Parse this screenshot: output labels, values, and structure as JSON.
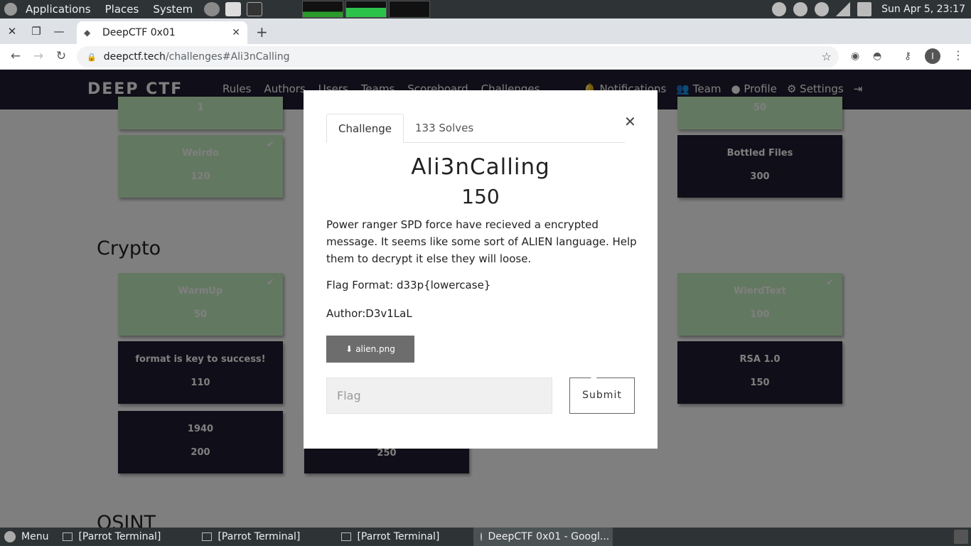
{
  "os": {
    "menus": [
      "Applications",
      "Places",
      "System"
    ],
    "clock": "Sun Apr  5, 23:17"
  },
  "browser": {
    "tab_title": "DeepCTF 0x01",
    "url_host": "deepctf.tech",
    "url_path": "/challenges#Ali3nCalling"
  },
  "site": {
    "logo": "DEEP CTF",
    "nav": [
      "Rules",
      "Authors",
      "Users",
      "Teams",
      "Scoreboard",
      "Challenges"
    ],
    "right_nav": [
      "Notifications",
      "Team",
      "Profile",
      "Settings"
    ]
  },
  "sections": {
    "crypto": "Crypto",
    "osint": "OSINT"
  },
  "cards": {
    "top_left_value": "1",
    "top_right_value": "50",
    "weirdo": {
      "name": "Weirdo",
      "value": "120"
    },
    "bottled": {
      "name": "Bottled Files",
      "value": "300"
    },
    "warmup": {
      "name": "WarmUp",
      "value": "50"
    },
    "wierdtext": {
      "name": "WierdText",
      "value": "100"
    },
    "format": {
      "name": "format is key to success!",
      "value": "110"
    },
    "rsa": {
      "name": "RSA 1.0",
      "value": "150"
    },
    "c1940": {
      "name": "1940",
      "value": "200"
    },
    "c250": {
      "value": "250"
    }
  },
  "modal": {
    "tab_challenge": "Challenge",
    "tab_solves": "133 Solves",
    "title": "Ali3nCalling",
    "value": "150",
    "description": "Power ranger SPD force have recieved a encrypted message. It seems like some sort of ALIEN language. Help them to decrypt it else they will loose.",
    "flag_format": "Flag Format: d33p{lowercase}",
    "author": "Author:D3v1LaL",
    "file": "alien.png",
    "flag_placeholder": "Flag",
    "submit": "Submit"
  },
  "taskbar": {
    "menu": "Menu",
    "items": [
      "[Parrot Terminal]",
      "[Parrot Terminal]",
      "[Parrot Terminal]",
      "DeepCTF 0x01 - Googl..."
    ]
  }
}
